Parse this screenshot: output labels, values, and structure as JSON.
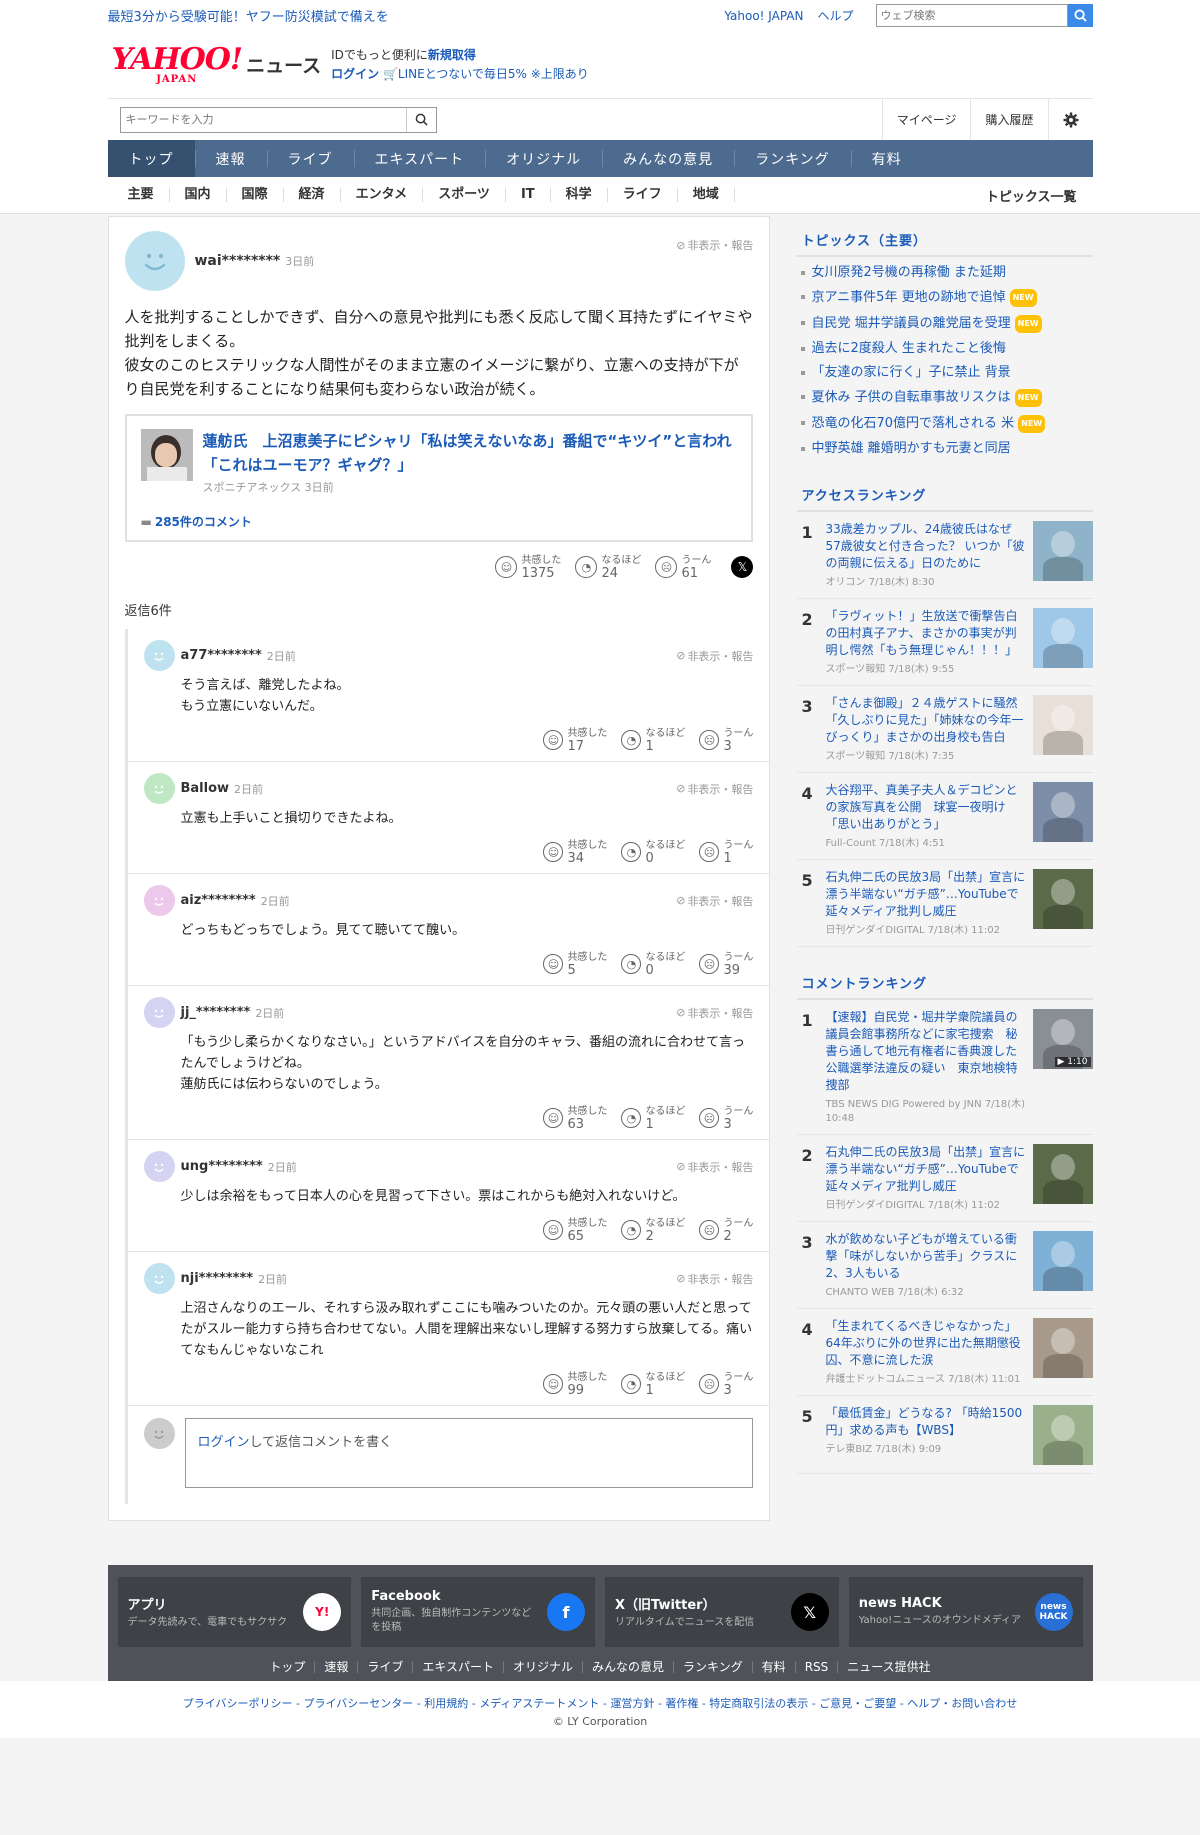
{
  "topbar": {
    "promo": "最短3分から受験可能！ヤフー防災模試で備えを",
    "yahoo_japan": "Yahoo! JAPAN",
    "help": "ヘルプ",
    "web_search_placeholder": "ウェブ検索"
  },
  "masthead": {
    "logo_text": "YAHOO!",
    "logo_sub": "JAPAN",
    "site_name": "ニュース",
    "id_prefix": "IDでもっと便利に",
    "signup": "新規取得",
    "login": "ログイン",
    "line_promo": "LINEとつないで毎日5% ※上限あり"
  },
  "search": {
    "placeholder": "キーワードを入力",
    "mypage": "マイページ",
    "purchase": "購入履歴"
  },
  "mainnav": [
    "トップ",
    "速報",
    "ライブ",
    "エキスパート",
    "オリジナル",
    "みんなの意見",
    "ランキング",
    "有料"
  ],
  "catnav": [
    "主要",
    "国内",
    "国際",
    "経済",
    "エンタメ",
    "スポーツ",
    "IT",
    "科学",
    "ライフ",
    "地域"
  ],
  "catnav_all": "トピックス一覧",
  "main_comment": {
    "user": "wai********",
    "ago": "3日前",
    "report": "非表示・報告",
    "body": "人を批判することしかできず、自分への意見や批判にも悉く反応して聞く耳持たずにイヤミや批判をしまくる。\n彼女のこのヒステリックな人間性がそのまま立憲のイメージに繋がり、立憲への支持が下がり自民党を利することになり結果何も変わらない政治が続く。",
    "article": {
      "title": "蓮舫氏　上沼恵美子にピシャリ「私は笑えないなあ」番組で“キツイ”と言われ「これはユーモア？ギャグ？」",
      "source": "スポニチアネックス 3日前",
      "comments": "285件のコメント"
    },
    "reactions": [
      {
        "label": "共感した",
        "count": "1375"
      },
      {
        "label": "なるほど",
        "count": "24"
      },
      {
        "label": "うーん",
        "count": "61"
      }
    ]
  },
  "replies_header": "返信6件",
  "replies": [
    {
      "user": "a77********",
      "ago": "2日前",
      "color": "#bfe2f0",
      "body": "そう言えば、離党したよね。\nもう立憲にいないんだ。",
      "reactions": [
        "17",
        "1",
        "3"
      ]
    },
    {
      "user": "Ballow",
      "ago": "2日前",
      "color": "#bfe8c2",
      "body": "立憲も上手いこと損切りできたよね。",
      "reactions": [
        "34",
        "0",
        "1"
      ]
    },
    {
      "user": "aiz********",
      "ago": "2日前",
      "color": "#ecc8ea",
      "body": "どっちもどっちでしょう。見てて聴いてて醜い。",
      "reactions": [
        "5",
        "0",
        "39"
      ]
    },
    {
      "user": "jj_********",
      "ago": "2日前",
      "color": "#d4d4f2",
      "body": "「もう少し柔らかくなりなさい。」というアドバイスを自分のキャラ、番組の流れに合わせて言ったんでしょうけどね。\n蓮舫氏には伝わらないのでしょう。",
      "reactions": [
        "63",
        "1",
        "3"
      ]
    },
    {
      "user": "ung********",
      "ago": "2日前",
      "color": "#d4d4f2",
      "body": "少しは余裕をもって日本人の心を見習って下さい。票はこれからも絶対入れないけど。",
      "reactions": [
        "65",
        "2",
        "2"
      ]
    },
    {
      "user": "nji********",
      "ago": "2日前",
      "color": "#bfe2f0",
      "body": "上沼さんなりのエール、それすら汲み取れずここにも噛みついたのか。元々頭の悪い人だと思ってたがスルー能力すら持ち合わせてない。人間を理解出来ないし理解する努力すら放棄してる。痛いてなもんじゃないなこれ",
      "reactions": [
        "99",
        "1",
        "3"
      ]
    }
  ],
  "react_labels": [
    "共感した",
    "なるほど",
    "うーん"
  ],
  "login_reply": {
    "link": "ログイン",
    "rest": "して返信コメントを書く"
  },
  "topics": {
    "title": "トピックス（主要）",
    "items": [
      {
        "text": "女川原発2号機の再稼働 また延期",
        "new": false
      },
      {
        "text": "京アニ事件5年 更地の跡地で追悼",
        "new": true
      },
      {
        "text": "自民党 堀井学議員の離党届を受理",
        "new": true
      },
      {
        "text": "過去に2度殺人 生まれたこと後悔",
        "new": false
      },
      {
        "text": "「友達の家に行く」子に禁止 背景",
        "new": false
      },
      {
        "text": "夏休み 子供の自転車事故リスクは",
        "new": true
      },
      {
        "text": "恐竜の化石70億円で落札される 米",
        "new": true
      },
      {
        "text": "中野英雄 離婚明かすも元妻と同居",
        "new": false
      }
    ],
    "new_label": "NEW"
  },
  "access_ranking": {
    "title": "アクセスランキング",
    "items": [
      {
        "n": "1",
        "title": "33歳差カップル、24歳彼氏はなぜ57歳彼女と付き合った？ いつか「彼の両親に伝える」日のために",
        "src": "オリコン 7/18(木) 8:30",
        "thumb": "#8fb3c9"
      },
      {
        "n": "2",
        "title": "「ラヴィット！」生放送で衝撃告白の田村真子アナ、まさかの事実が判明し愕然「もう無理じゃん！！！」",
        "src": "スポーツ報知 7/18(木) 9:55",
        "thumb": "#9ec7e8"
      },
      {
        "n": "3",
        "title": "「さんま御殿」２４歳ゲストに騒然「久しぶりに見た」「姉妹なの今年一びっくり」まさかの出身校も告白",
        "src": "スポーツ報知 7/18(木) 7:35",
        "thumb": "#e8e0d8"
      },
      {
        "n": "4",
        "title": "大谷翔平、真美子夫人＆デコピンとの家族写真を公開　球宴一夜明け「思い出ありがとう」",
        "src": "Full-Count 7/18(木) 4:51",
        "thumb": "#7d8ea8"
      },
      {
        "n": "5",
        "title": "石丸伸二氏の民放3局「出禁」宣言に漂う半端ない“ガチ感”…YouTubeで延々メディア批判し威圧",
        "src": "日刊ゲンダイDIGITAL 7/18(木) 11:02",
        "thumb": "#5a6b4a"
      }
    ]
  },
  "comment_ranking": {
    "title": "コメントランキング",
    "items": [
      {
        "n": "1",
        "title": "【速報】自民党・堀井学衆院議員の議員会館事務所などに家宅捜索　秘書ら通して地元有権者に香典渡した公職選挙法違反の疑い　東京地検特捜部",
        "src": "TBS NEWS DIG Powered by JNN 7/18(木) 10:48",
        "thumb": "#8a8f96",
        "video": "▶ 1:10"
      },
      {
        "n": "2",
        "title": "石丸伸二氏の民放3局「出禁」宣言に漂う半端ない“ガチ感”…YouTubeで延々メディア批判し威圧",
        "src": "日刊ゲンダイDIGITAL 7/18(木) 11:02",
        "thumb": "#5a6b4a",
        "video": ""
      },
      {
        "n": "3",
        "title": "水が飲めない子どもが増えている衝撃「味がしないから苦手」クラスに2、3人もいる",
        "src": "CHANTO WEB 7/18(木) 6:32",
        "thumb": "#7fb0d6",
        "video": ""
      },
      {
        "n": "4",
        "title": "「生まれてくるべきじゃなかった」64年ぶりに外の世界に出た無期懲役囚、不意に流した涙",
        "src": "弁護士ドットコムニュース 7/18(木) 11:01",
        "thumb": "#a89a8a",
        "video": ""
      },
      {
        "n": "5",
        "title": "「最低賃金」どうなる? 「時給1500円」求める声も【WBS】",
        "src": "テレ東BIZ 7/18(木) 9:09",
        "thumb": "#9bb08a",
        "video": ""
      }
    ]
  },
  "footer": {
    "cards": [
      {
        "title": "アプリ",
        "desc": "データ先読みで、電車でもサクサク",
        "icon": "Y!",
        "icon_bg": "#ffffff",
        "icon_color": "#ff0033"
      },
      {
        "title": "Facebook",
        "desc": "共同企画、独自制作コンテンツなどを投稿",
        "icon": "f",
        "icon_bg": "#1877f2",
        "icon_color": "#ffffff"
      },
      {
        "title": "X（旧Twitter）",
        "desc": "リアルタイムでニュースを配信",
        "icon": "𝕏",
        "icon_bg": "#000000",
        "icon_color": "#ffffff"
      },
      {
        "title": "news HACK",
        "desc": "Yahoo!ニュースのオウンドメディア",
        "icon": "news HACK",
        "icon_bg": "#2a6fd6",
        "icon_color": "#ffffff"
      }
    ],
    "links": [
      "トップ",
      "速報",
      "ライブ",
      "エキスパート",
      "オリジナル",
      "みんなの意見",
      "ランキング",
      "有料",
      "RSS",
      "ニュース提供社"
    ],
    "legal": "プライバシーポリシー - プライバシーセンター - 利用規約 - メディアステートメント - 運営方針 - 著作権 - 特定商取引法の表示 - ご意見・ご要望 - ヘルプ・お問い合わせ",
    "copyright": "© LY Corporation"
  }
}
